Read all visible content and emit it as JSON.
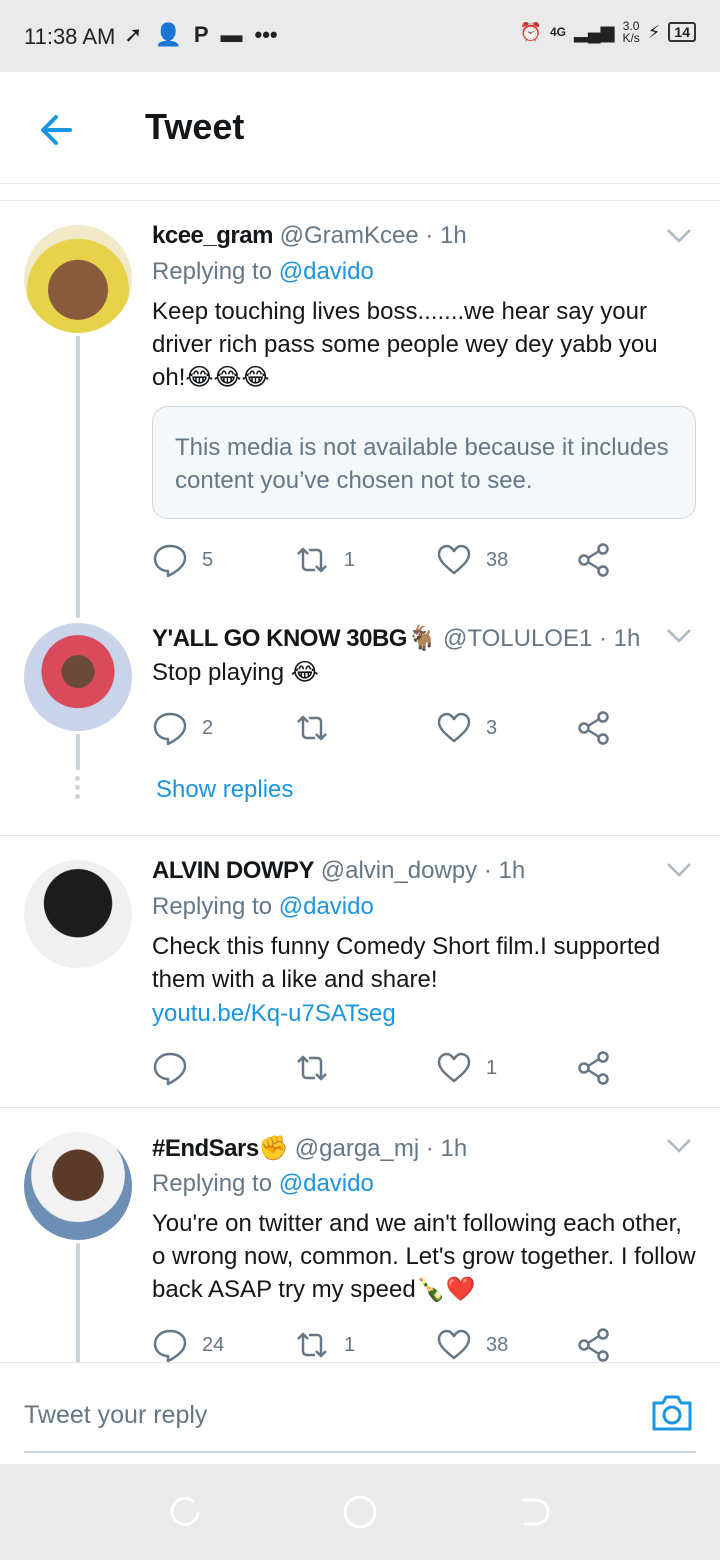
{
  "status_bar": {
    "time": "11:38 AM",
    "network": "4G",
    "speed_value": "3.0",
    "speed_unit": "K/s",
    "battery": "14"
  },
  "header": {
    "title": "Tweet"
  },
  "tweets": [
    {
      "name": "kcee_gram",
      "handle": "@GramKcee",
      "time": "· 1h",
      "replying_prefix": "Replying to",
      "replying_to": "@davido",
      "text": "Keep touching lives boss.......we hear say your driver rich pass some people wey dey yabb you oh!😂😂😂",
      "media_notice": "This media is not available because it includes content you’ve chosen not to see.",
      "replies": "5",
      "retweets": "1",
      "likes": "38"
    },
    {
      "name": "Y'ALL GO KNOW 30BG🐐",
      "handle": "@TOLULOE1",
      "time": "· 1h",
      "text": "Stop playing 😂",
      "replies": "2",
      "retweets": "",
      "likes": "3",
      "show_replies": "Show replies"
    },
    {
      "name": "ALVIN DOWPY",
      "handle": "@alvin_dowpy",
      "time": "· 1h",
      "replying_prefix": "Replying to",
      "replying_to": "@davido",
      "text": "Check this funny Comedy Short film.I supported them with a like and share!",
      "link": "youtu.be/Kq-u7SATseg",
      "replies": "",
      "retweets": "",
      "likes": "1"
    },
    {
      "name": "#EndSars✊",
      "handle": "@garga_mj",
      "time": "· 1h",
      "replying_prefix": "Replying to",
      "replying_to": "@davido",
      "text": "You're on twitter and we ain't following each other, o wrong now, common. Let's grow together. I follow back ASAP try my speed🍾❤️",
      "replies": "24",
      "retweets": "1",
      "likes": "38"
    }
  ],
  "reply_bar": {
    "placeholder": "Tweet your reply"
  },
  "colors": {
    "accent": "#1b95e0",
    "muted": "#657786",
    "border": "#e1e8ed"
  }
}
